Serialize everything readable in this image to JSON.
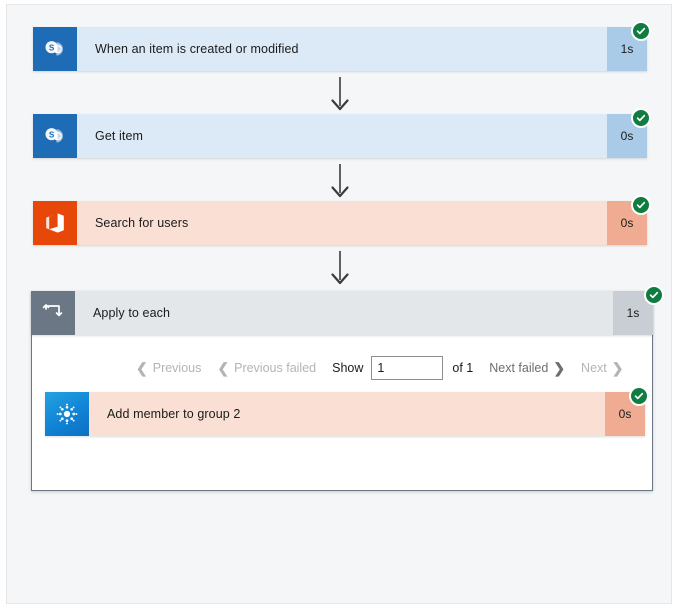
{
  "flow": {
    "steps": [
      {
        "name": "When an item is created or modified",
        "icon": "sharepoint-icon",
        "duration": "1s",
        "status": "succeeded"
      },
      {
        "name": "Get item",
        "icon": "sharepoint-icon",
        "duration": "0s",
        "status": "succeeded"
      },
      {
        "name": "Search for users",
        "icon": "office365-icon",
        "duration": "0s",
        "status": "succeeded"
      }
    ],
    "scope": {
      "name": "Apply to each",
      "icon": "loop-icon",
      "duration": "1s",
      "status": "succeeded",
      "pagination": {
        "previous_label": "Previous",
        "previous_failed_label": "Previous failed",
        "show_label": "Show",
        "page_value": "1",
        "page_placeholder": "1",
        "of_label": "of 1",
        "next_failed_label": "Next failed",
        "next_label": "Next",
        "prev_chevron": "❮",
        "prev_failed_chevron": "❮",
        "next_failed_chevron": "❯",
        "next_chevron": "❯"
      },
      "children": [
        {
          "name": "Add member to group 2",
          "icon": "azure-ad-icon",
          "duration": "0s",
          "status": "succeeded"
        }
      ]
    }
  },
  "colors": {
    "success": "#107c41",
    "sharepoint": "#1e6cb5",
    "office365": "#e8470a",
    "azure_ad": "#1183d6",
    "scope_icon": "#6b7785",
    "card_blue": "#dceaf7",
    "card_red": "#fadfd5",
    "card_grey": "#e4e7ea",
    "canvas": "#f5f6f7"
  }
}
